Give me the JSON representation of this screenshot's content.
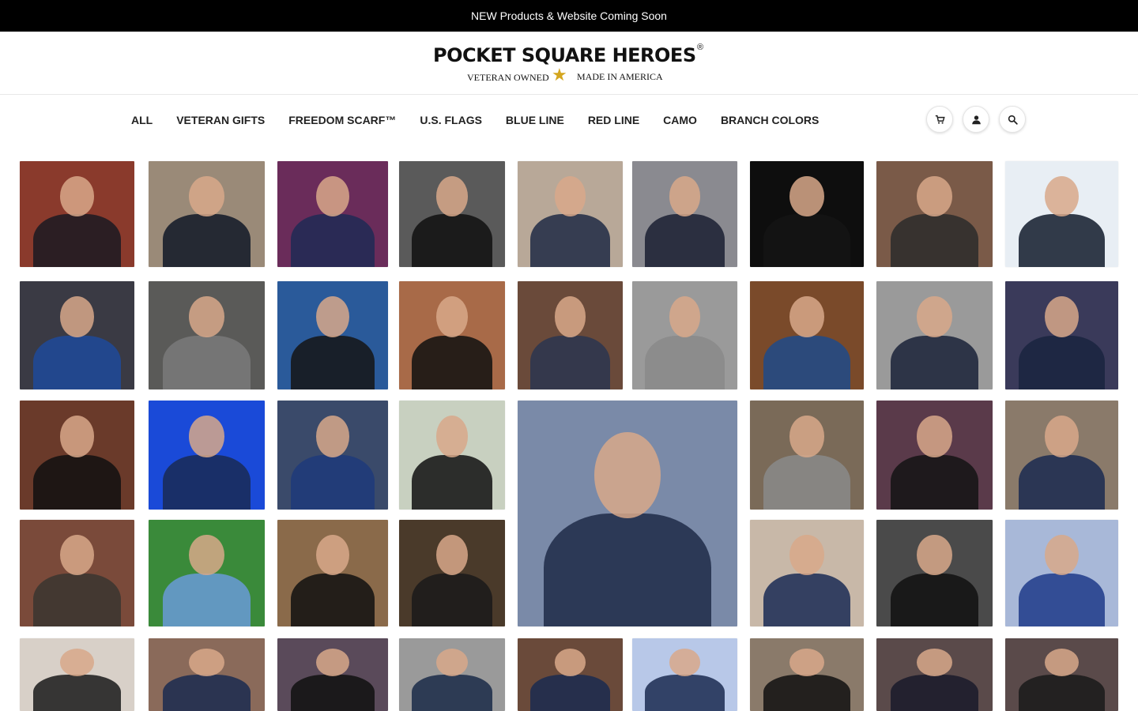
{
  "announcement": "NEW Products & Website Coming Soon",
  "brand": {
    "name": "POCKET SQUARE HEROES",
    "registered": "®",
    "tagline_left": "VETERAN OWNED",
    "tagline_right": "MADE IN AMERICA",
    "star_color": "#d4a61f"
  },
  "nav": {
    "items": [
      "ALL",
      "VETERAN GIFTS",
      "FREEDOM SCARF™",
      "U.S. FLAGS",
      "BLUE LINE",
      "RED LINE",
      "CAMO",
      "BRANCH COLORS"
    ]
  },
  "header_icons": [
    "cart-icon",
    "account-icon",
    "search-icon"
  ],
  "gallery": {
    "photos": [
      {
        "bg": "#8a3a2c",
        "suit": "#1a1a22"
      },
      {
        "bg": "#9a8a78",
        "suit": "#111827"
      },
      {
        "bg": "#6a2c5a",
        "suit": "#1f2a55"
      },
      {
        "bg": "#5a5a5a",
        "suit": "#111111"
      },
      {
        "bg": "#b8a898",
        "suit": "#1f2a44"
      },
      {
        "bg": "#8a8a90",
        "suit": "#1a1f33"
      },
      {
        "bg": "#0e0e0e",
        "suit": "#141414"
      },
      {
        "bg": "#7a5a48",
        "suit": "#2b2b2b"
      },
      {
        "bg": "#e8eef4",
        "suit": "#111a2a"
      },
      {
        "bg": "#3a3a44",
        "suit": "#1f4a9a"
      },
      {
        "bg": "#5a5a58",
        "suit": "#7a7a7a"
      },
      {
        "bg": "#2a5a9a",
        "suit": "#151515"
      },
      {
        "bg": "#a86a48",
        "suit": "#101010"
      },
      {
        "bg": "#6a4a3a",
        "suit": "#2a3550"
      },
      {
        "bg": "#9a9a9a",
        "suit": "#8a8a8a"
      },
      {
        "bg": "#7a4a2a",
        "suit": "#1f4a8a"
      },
      {
        "bg": "#9a9a9a",
        "suit": "#1a2238"
      },
      {
        "bg": "#3a3a5a",
        "suit": "#1a2540"
      },
      {
        "bg": "#6a3a2a",
        "suit": "#111111"
      },
      {
        "bg": "#1a4ad8",
        "suit": "#1a2a55"
      },
      {
        "bg": "#3a4a6a",
        "suit": "#1f3a7a"
      },
      {
        "bg": "#c8d0c0",
        "suit": "#111111"
      },
      {
        "bg": "#7a8aa8",
        "suit": "#1f2a48"
      },
      {
        "bg": "#7a6a58",
        "suit": "#8a8a8a"
      },
      {
        "bg": "#5a3a4a",
        "suit": "#141414"
      },
      {
        "bg": "#8a7a6a",
        "suit": "#1a2a50"
      },
      {
        "bg": "#7a4a3a",
        "suit": "#3a3530"
      },
      {
        "bg": "#3a8a3a",
        "suit": "#6a9ad8"
      },
      {
        "bg": "#8a6a4a",
        "suit": "#111111"
      },
      {
        "bg": "#4a3a2a",
        "suit": "#1a1a1a"
      },
      {
        "bg": "#c8b8a8",
        "suit": "#1a2a55"
      },
      {
        "bg": "#4a4a4a",
        "suit": "#111111"
      },
      {
        "bg": "#a8b8d8",
        "suit": "#1f3a8a"
      },
      {
        "bg": "#d8d0c8",
        "suit": "#1a1a1a"
      },
      {
        "bg": "#8a6a5a",
        "suit": "#1a2a50"
      },
      {
        "bg": "#5a4a5a",
        "suit": "#111111"
      },
      {
        "bg": "#9a9a9a",
        "suit": "#1a2a48"
      },
      {
        "bg": "#6a4a3a",
        "suit": "#1a2a50"
      },
      {
        "bg": "#b8c8e8",
        "suit": "#1a2a50"
      },
      {
        "bg": "#8a7a6a",
        "suit": "#111111"
      },
      {
        "bg": "#5a4a4a",
        "suit": "#1a1a2a"
      },
      {
        "bg": "#5a4a4a",
        "suit": "#1a1a1a"
      }
    ]
  }
}
